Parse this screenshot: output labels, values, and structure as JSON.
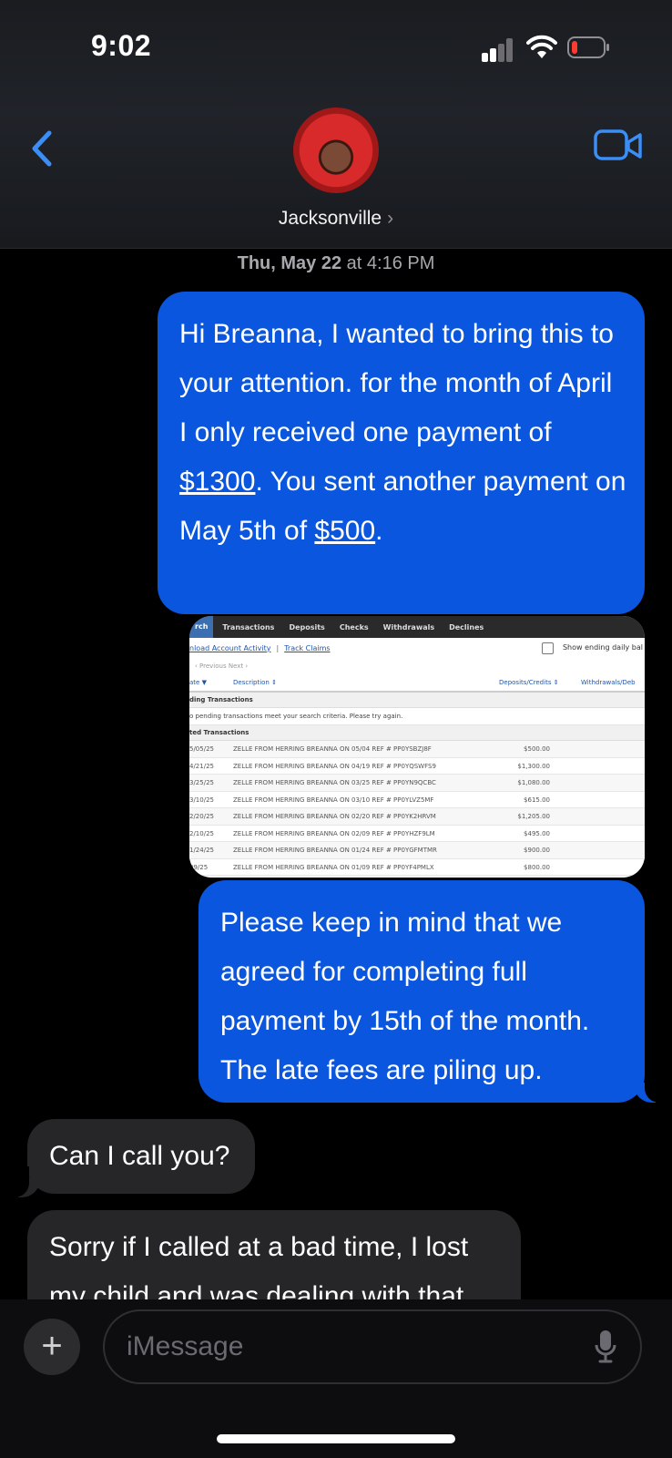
{
  "status_bar": {
    "time": "9:02"
  },
  "header": {
    "contact_name": "Jacksonville",
    "contact_chevron": "›",
    "back_icon": "chevron-left-icon",
    "video_icon": "video-camera-icon"
  },
  "conversation": {
    "timestamp_day": "Thu, May 22",
    "timestamp_at": " at 4:16 PM",
    "messages": [
      {
        "direction": "sent",
        "parts": [
          "Hi Breanna, I wanted to bring this to your attention. for the month of April I only received one payment of ",
          "$1300",
          ". You sent another payment on May 5th of ",
          "$500",
          "."
        ]
      },
      {
        "direction": "sent",
        "type": "image",
        "screenshot": {
          "nav_tabs": [
            "rch",
            "Transactions",
            "Deposits",
            "Checks",
            "Withdrawals",
            "Declines"
          ],
          "links": [
            "nload Account Activity",
            "|",
            "Track Claims"
          ],
          "checkbox_label": "Show ending daily bal",
          "pager": "‹ Previous   Next ›",
          "columns": [
            "ate ▼",
            "Description ⇕",
            "Deposits/Credits ⇕",
            "Withdrawals/Deb"
          ],
          "pending_section": "ding Transactions",
          "pending_empty": "o pending transactions meet your search criteria. Please try again.",
          "posted_section": "ted Transactions",
          "rows": [
            {
              "date": "5/05/25",
              "desc": "ZELLE FROM HERRING BREANNA ON 05/04 REF # PP0YSBZJ8F",
              "amount": "$500.00"
            },
            {
              "date": "4/21/25",
              "desc": "ZELLE FROM HERRING BREANNA ON 04/19 REF # PP0YQSWFS9",
              "amount": "$1,300.00"
            },
            {
              "date": "3/25/25",
              "desc": "ZELLE FROM HERRING BREANNA ON 03/25 REF # PP0YN9QCBC",
              "amount": "$1,080.00"
            },
            {
              "date": "3/10/25",
              "desc": "ZELLE FROM HERRING BREANNA ON 03/10 REF # PP0YLVZ5MF",
              "amount": "$615.00"
            },
            {
              "date": "2/20/25",
              "desc": "ZELLE FROM HERRING BREANNA ON 02/20 REF # PP0YK2HRVM",
              "amount": "$1,205.00"
            },
            {
              "date": "2/10/25",
              "desc": "ZELLE FROM HERRING BREANNA ON 02/09 REF # PP0YHZF9LM",
              "amount": "$495.00"
            },
            {
              "date": "1/24/25",
              "desc": "ZELLE FROM HERRING BREANNA ON 01/24 REF # PP0YGFMTMR",
              "amount": "$900.00"
            },
            {
              "date": "09/25",
              "desc": "ZELLE FROM HERRING BREANNA ON 01/09 REF # PP0YF4PMLX",
              "amount": "$800.00"
            }
          ]
        }
      },
      {
        "direction": "sent",
        "text": "Please keep in mind that we agreed for completing full payment by 15th of the month. The late fees are piling up."
      },
      {
        "direction": "received",
        "text": "Can I call you?"
      },
      {
        "direction": "received",
        "text": "Sorry if I called at a bad time, I lost my child and was dealing with that"
      }
    ]
  },
  "composer": {
    "plus_label": "+",
    "placeholder": "iMessage",
    "mic_icon": "microphone-icon"
  },
  "colors": {
    "sent_bubble": "#0a56de",
    "received_bubble": "#262629",
    "accent": "#3a8ef6"
  }
}
